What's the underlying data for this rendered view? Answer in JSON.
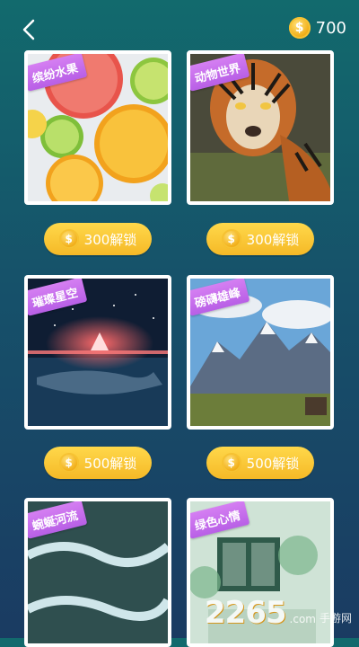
{
  "header": {
    "coin_balance": "700",
    "coin_icon": "coin-icon",
    "back_icon": "back-icon"
  },
  "cards": [
    {
      "tag": "缤纷水果",
      "price_label": "300解锁"
    },
    {
      "tag": "动物世界",
      "price_label": "300解锁"
    },
    {
      "tag": "璀璨星空",
      "price_label": "500解锁"
    },
    {
      "tag": "磅礴雄峰",
      "price_label": "500解锁"
    },
    {
      "tag": "蜿蜒河流",
      "price_label": ""
    },
    {
      "tag": "绿色心情",
      "price_label": ""
    }
  ],
  "watermark": {
    "main": "2265",
    "suffix": "手游网",
    "domain": ".com"
  },
  "colors": {
    "accent_yellow": "#f5b927",
    "tag_purple": "#c26be9",
    "bg_top": "#126a6d",
    "bg_bottom": "#1a3b62"
  }
}
